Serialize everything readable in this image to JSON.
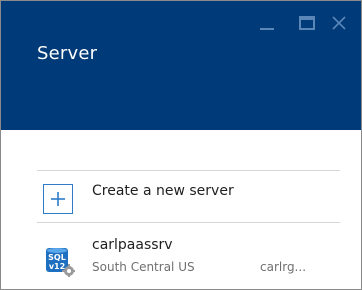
{
  "blade": {
    "title": "Server",
    "controls": {
      "minimize": "minimize-icon",
      "maximize": "maximize-icon",
      "close": "close-icon"
    }
  },
  "actions": {
    "create_label": "Create a new server",
    "create_icon": "plus-icon"
  },
  "servers": [
    {
      "name": "carlpaassrv",
      "location": "South Central US",
      "resource_group": "carlrg...",
      "icon": "sql-server-icon",
      "icon_text_line1": "SQL",
      "icon_text_line2": "v12"
    }
  ],
  "colors": {
    "header": "#003a78",
    "accent": "#2e7bc8",
    "control": "#5a86b8"
  }
}
